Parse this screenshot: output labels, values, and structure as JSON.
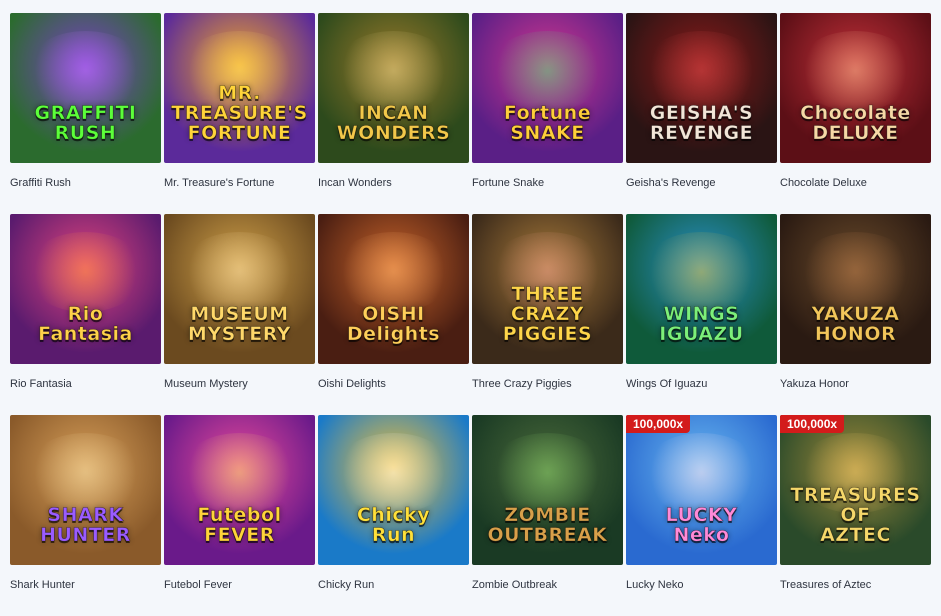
{
  "games": [
    {
      "name": "Graffiti Rush",
      "art": "GRAFFITI\nRUSH",
      "badge": "",
      "bg": "#2b6b2e",
      "bg2": "#7a3fc6",
      "fg": "#5cff3a",
      "glow": "#c47bff"
    },
    {
      "name": "Mr. Treasure's Fortune",
      "art": "MR.\nTREASURE'S\nFORTUNE",
      "badge": "",
      "bg": "#5b2a9a",
      "bg2": "#f0a52a",
      "fg": "#ffd43a",
      "glow": "#ffe36b"
    },
    {
      "name": "Incan Wonders",
      "art": "INCAN\nWONDERS",
      "badge": "",
      "bg": "#2d4a1c",
      "bg2": "#9a7a2a",
      "fg": "#f2c84a",
      "glow": "#e7d38a"
    },
    {
      "name": "Fortune Snake",
      "art": "Fortune\nSNAKE",
      "badge": "",
      "bg": "#5a1f86",
      "bg2": "#d2378f",
      "fg": "#ffcf3a",
      "glow": "#49e07a"
    },
    {
      "name": "Geisha's Revenge",
      "art": "GEISHA'S\nREVENGE",
      "badge": "",
      "bg": "#2a1414",
      "bg2": "#8c1a1a",
      "fg": "#f3e6d8",
      "glow": "#d84a4a"
    },
    {
      "name": "Chocolate Deluxe",
      "art": "Chocolate\nDELUXE",
      "badge": "",
      "bg": "#5c0f16",
      "bg2": "#c23039",
      "fg": "#f7d9a6",
      "glow": "#f5b98a"
    },
    {
      "name": "Rio Fantasia",
      "art": "Rio\nFantasia",
      "badge": "",
      "bg": "#5a1b6e",
      "bg2": "#e0447d",
      "fg": "#ffd14a",
      "glow": "#ff9a3c"
    },
    {
      "name": "Museum Mystery",
      "art": "MUSEUM\nMYSTERY",
      "badge": "",
      "bg": "#6b4a1f",
      "bg2": "#d1a24a",
      "fg": "#ffd86a",
      "glow": "#f4d7a0"
    },
    {
      "name": "Oishi Delights",
      "art": "OISHI\nDelights",
      "badge": "",
      "bg": "#4a1e12",
      "bg2": "#c8642a",
      "fg": "#ffcf5a",
      "glow": "#ffb36b"
    },
    {
      "name": "Three Crazy Piggies",
      "art": "THREE\nCRAZY\nPIGGIES",
      "badge": "",
      "bg": "#3b2a1a",
      "bg2": "#a87a3a",
      "fg": "#ffd64a",
      "glow": "#e79a8a"
    },
    {
      "name": "Wings Of Iguazu",
      "art": "WINGS\nIGUAZU",
      "badge": "",
      "bg": "#0f5a3a",
      "bg2": "#2a8fc8",
      "fg": "#7cf07a",
      "glow": "#e3c03a"
    },
    {
      "name": "Yakuza Honor",
      "art": "YAKUZA\nHONOR",
      "badge": "",
      "bg": "#2a1a12",
      "bg2": "#6a4a2a",
      "fg": "#f2c65a",
      "glow": "#b87a4a"
    },
    {
      "name": "Shark Hunter",
      "art": "SHARK\nHUNTER",
      "badge": "",
      "bg": "#8a5a2a",
      "bg2": "#d8a05a",
      "fg": "#9a5cff",
      "glow": "#f0d8a0"
    },
    {
      "name": "Futebol Fever",
      "art": "Futebol\nFEVER",
      "badge": "",
      "bg": "#6a1a8a",
      "bg2": "#e84a9a",
      "fg": "#ffd43a",
      "glow": "#f4e06a"
    },
    {
      "name": "Chicky Run",
      "art": "Chicky\nRun",
      "badge": "",
      "bg": "#1a7ac8",
      "bg2": "#f0c03a",
      "fg": "#ffe03a",
      "glow": "#ffffff"
    },
    {
      "name": "Zombie Outbreak",
      "art": "ZOMBIE\nOUTBREAK",
      "badge": "",
      "bg": "#1a3a24",
      "bg2": "#4a6a3a",
      "fg": "#d8a04a",
      "glow": "#8ad06a"
    },
    {
      "name": "Lucky Neko",
      "art": "LUCKY\nNeko",
      "badge": "100,000x",
      "bg": "#2a6ad0",
      "bg2": "#6ab8f0",
      "fg": "#ff8ad8",
      "glow": "#ffe0f0"
    },
    {
      "name": "Treasures of Aztec",
      "art": "TREASURES OF\nAZTEC",
      "badge": "100,000x",
      "bg": "#2a4a2a",
      "bg2": "#a08a3a",
      "fg": "#f6d86a",
      "glow": "#f0c86a"
    }
  ]
}
